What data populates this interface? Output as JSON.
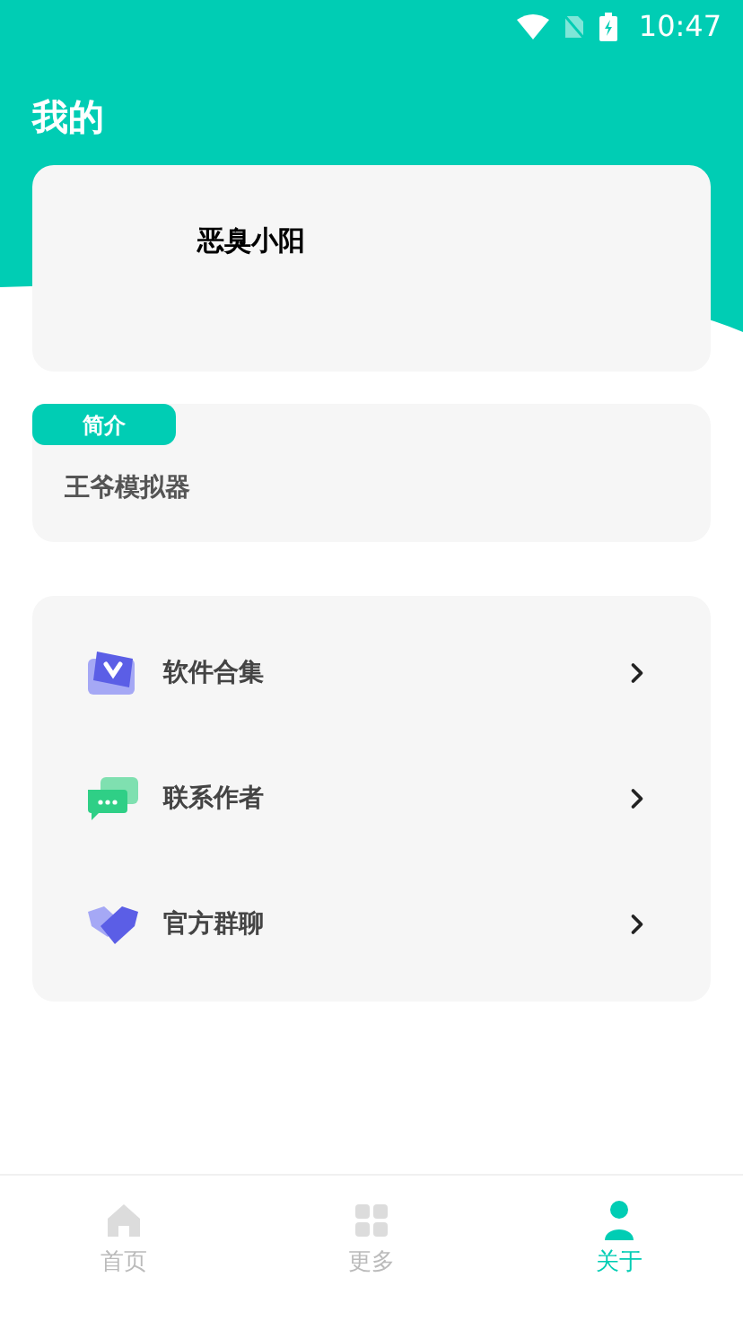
{
  "status_bar": {
    "time": "10:47"
  },
  "header": {
    "title": "我的"
  },
  "profile": {
    "name": "恶臭小阳"
  },
  "intro": {
    "label": "简介",
    "text": "王爷模拟器"
  },
  "menu": [
    {
      "kind": "apps",
      "label": "软件合集"
    },
    {
      "kind": "chat",
      "label": "联系作者"
    },
    {
      "kind": "group",
      "label": "官方群聊"
    }
  ],
  "tabs": [
    {
      "kind": "home",
      "label": "首页",
      "selected": false
    },
    {
      "kind": "more",
      "label": "更多",
      "selected": false
    },
    {
      "kind": "about",
      "label": "关于",
      "selected": true
    }
  ]
}
